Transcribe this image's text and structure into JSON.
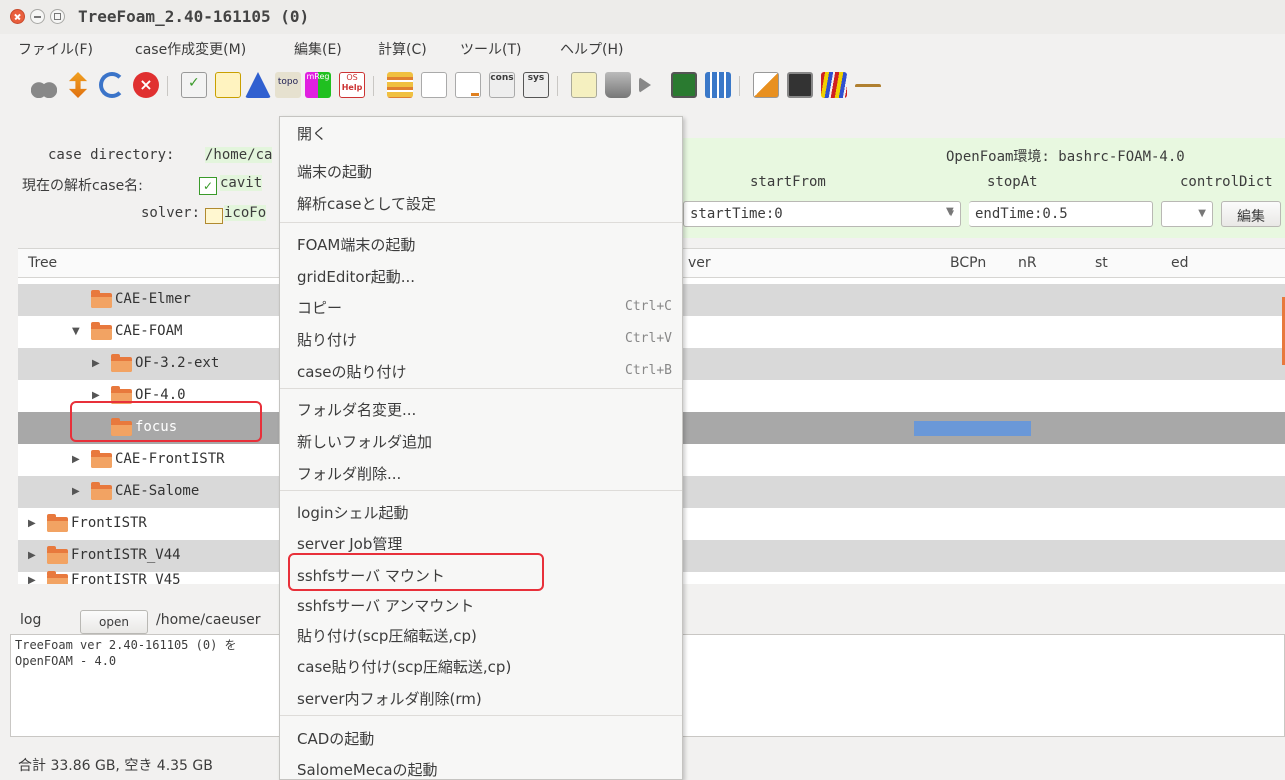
{
  "window": {
    "title": "TreeFoam_2.40-161105 (0)"
  },
  "menubar": [
    "ファイル(F)",
    "case作成変更(M)",
    "編集(E)",
    "計算(C)",
    "ツール(T)",
    "ヘルプ(H)"
  ],
  "toolbar": {
    "icons": [
      "scissors-icon",
      "arrows-icon",
      "refresh-icon",
      "stop-icon",
      "checklist-icon",
      "case-icon",
      "triangle-icon",
      "topo-icon",
      "mreg-icon",
      "help-os-icon",
      "table-icon",
      "document-icon",
      "edit-document-icon",
      "cons-icon",
      "sys-icon",
      "folder-star-icon",
      "trash-icon",
      "play-icon",
      "monitor-icon",
      "grid-icon",
      "salome-icon",
      "terminal-icon",
      "bars-icon",
      "pointer-icon"
    ],
    "labels": {
      "topo": "topo",
      "mreg": "mReg",
      "helpos": "Help",
      "os": "OS",
      "cons": "cons",
      "sys": "sys"
    }
  },
  "info": {
    "case_dir_label": "case directory:",
    "case_dir_value": "/home/ca",
    "case_name_label": "現在の解析case名:",
    "case_name_value": "cavit",
    "solver_label": "solver:",
    "solver_value": "icoFo",
    "env": "OpenFoam環境: bashrc-FOAM-4.0",
    "start_label": "startFrom",
    "stop_label": "stopAt",
    "control_label": "controlDict",
    "start_value": "startTime:0",
    "stop_value": "endTime:0.5",
    "edit_button": "編集"
  },
  "tree": {
    "headers": {
      "tree": "Tree",
      "solver": "ver",
      "bcpn": "BCPn",
      "nr": "nR",
      "st": "st",
      "ed": "ed"
    },
    "rows": [
      {
        "label": "CAE-Elmer"
      },
      {
        "label": "CAE-FOAM"
      },
      {
        "label": "OF-3.2-ext"
      },
      {
        "label": "OF-4.0"
      },
      {
        "label": "focus"
      },
      {
        "label": "CAE-FrontISTR"
      },
      {
        "label": "CAE-Salome"
      },
      {
        "label": "FrontISTR"
      },
      {
        "label": "FrontISTR_V44"
      },
      {
        "label": "FrontISTR_V45"
      }
    ]
  },
  "log": {
    "label": "log",
    "open_button": "open",
    "path": "/home/caeuser",
    "lines": [
      "TreeFoam ver 2.40-161105  (0) を",
      "OpenFOAM - 4.0"
    ]
  },
  "status": "合計 33.86 GB,  空き 4.35 GB",
  "context_menu": {
    "items": [
      {
        "label": "開く"
      },
      {
        "label": "端末の起動"
      },
      {
        "label": "解析caseとして設定"
      },
      {
        "label": "FOAM端末の起動"
      },
      {
        "label": "gridEditor起動..."
      },
      {
        "label": "コピー",
        "shortcut": "Ctrl+C"
      },
      {
        "label": "貼り付け",
        "shortcut": "Ctrl+V"
      },
      {
        "label": "caseの貼り付け",
        "shortcut": "Ctrl+B"
      },
      {
        "label": "フォルダ名変更..."
      },
      {
        "label": "新しいフォルダ追加"
      },
      {
        "label": "フォルダ削除..."
      },
      {
        "label": "loginシェル起動"
      },
      {
        "label": "server Job管理"
      },
      {
        "label": "sshfsサーバ マウント"
      },
      {
        "label": "sshfsサーバ アンマウント"
      },
      {
        "label": "貼り付け(scp圧縮転送,cp)"
      },
      {
        "label": "case貼り付け(scp圧縮転送,cp)"
      },
      {
        "label": "server内フォルダ削除(rm)"
      },
      {
        "label": "CADの起動"
      },
      {
        "label": "SalomeMecaの起動"
      }
    ]
  },
  "colors": {
    "highlight_box": "#e8303a",
    "folder": "#e8793d",
    "panel_green": "#e8f8e0"
  }
}
